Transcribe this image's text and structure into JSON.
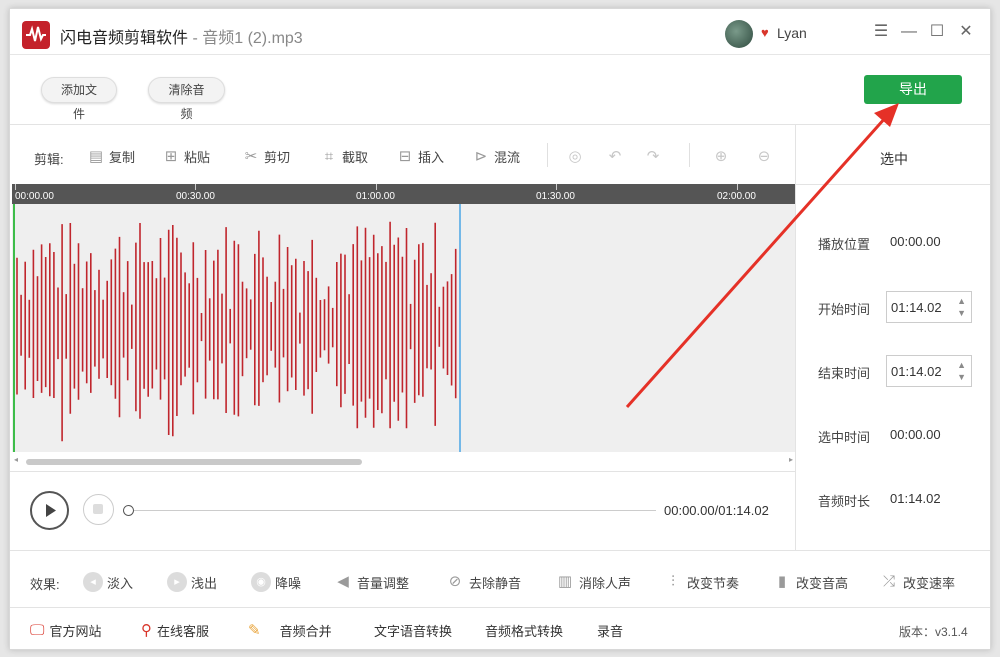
{
  "app": {
    "title": "闪电音频剪辑软件",
    "title_sep": " - ",
    "file_name": "音频1 (2).mp3",
    "user_name": "Lyan",
    "accent_color": "#22a44b",
    "brand_color": "#c4222b"
  },
  "window_controls": {
    "menu": "☰",
    "minimize": "—",
    "maximize": "☐",
    "close": "✕"
  },
  "top_actions": {
    "add_file": "添加文件",
    "clear_audio": "清除音频",
    "export": "导出"
  },
  "edit_toolbar": {
    "label": "剪辑:",
    "tools": [
      {
        "label": "复制",
        "icon": "copy-icon"
      },
      {
        "label": "粘贴",
        "icon": "paste-icon"
      },
      {
        "label": "剪切",
        "icon": "scissors-icon"
      },
      {
        "label": "截取",
        "icon": "crop-icon"
      },
      {
        "label": "插入",
        "icon": "insert-icon"
      },
      {
        "label": "混流",
        "icon": "mix-icon"
      }
    ],
    "icon_buttons": [
      "listen-icon",
      "undo-icon",
      "redo-icon",
      "zoom-in-icon",
      "zoom-out-icon"
    ]
  },
  "timeline": {
    "ticks": [
      "00:00.00",
      "00:30.00",
      "01:00.00",
      "01:30.00",
      "02:00.00"
    ]
  },
  "waveform": {
    "color": "#c0262d",
    "played_fraction": 0.0,
    "cursor_time": "01:14.02"
  },
  "player": {
    "current_time": "00:00.00",
    "duration": "01:14.02",
    "time_separator": "/"
  },
  "selection_panel": {
    "header": "选中",
    "play_position_label": "播放位置",
    "play_position": "00:00.00",
    "start_label": "开始时间",
    "start": "01:14.02",
    "end_label": "结束时间",
    "end": "01:14.02",
    "selected_label": "选中时间",
    "selected": "00:00.00",
    "duration_label": "音频时长",
    "duration": "01:14.02"
  },
  "effects": {
    "label": "效果:",
    "items": [
      "淡入",
      "浅出",
      "降噪",
      "音量调整",
      "去除静音",
      "消除人声",
      "改变节奏",
      "改变音高",
      "改变速率"
    ]
  },
  "footer": {
    "website": "官方网站",
    "support": "在线客服",
    "merge": "音频合并",
    "tts": "文字语音转换",
    "convert": "音频格式转换",
    "record": "录音",
    "version": "版本：v3.1.4"
  }
}
